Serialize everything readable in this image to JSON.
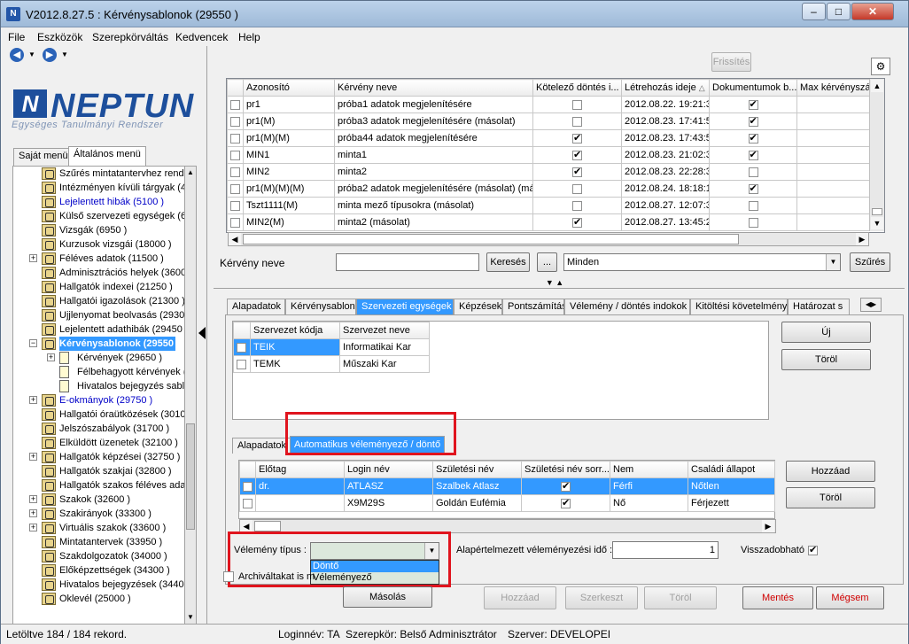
{
  "window": {
    "title": "V2012.8.27.5 : Kérvénysablonok (29550 )"
  },
  "menu": [
    "File",
    "Eszközök",
    "Szerepkörváltás",
    "Kedvencek",
    "Help"
  ],
  "logo": {
    "name": "NEPTUN",
    "subtitle": "Egységes Tanulmányi Rendszer"
  },
  "left_tabs": [
    "Saját menü",
    "Általános menü"
  ],
  "tree": [
    {
      "label": "Szűrés mintatantervhez rende",
      "style": "normal",
      "indent": 1,
      "icon": "tree-node-icon"
    },
    {
      "label": "Intézményen kívüli tárgyak (4",
      "style": "normal",
      "indent": 1,
      "icon": "tree-node-icon"
    },
    {
      "label": "Lejelentett hibák (5100 )",
      "style": "blue",
      "indent": 1,
      "icon": "tree-node-icon"
    },
    {
      "label": "Külső szervezeti egységek (6",
      "style": "normal",
      "indent": 1,
      "icon": "tree-node-icon"
    },
    {
      "label": "Vizsgák (6950 )",
      "style": "normal",
      "indent": 1,
      "icon": "tree-node-icon"
    },
    {
      "label": "Kurzusok vizsgái (18000 )",
      "style": "normal",
      "indent": 1,
      "icon": "tree-node-icon"
    },
    {
      "label": "Féléves adatok (11500 )",
      "style": "normal",
      "indent": 1,
      "icon": "tree-node-icon",
      "expander": "+"
    },
    {
      "label": "Adminisztrációs helyek (3600",
      "style": "normal",
      "indent": 1,
      "icon": "tree-node-icon"
    },
    {
      "label": "Hallgatók indexei (21250 )",
      "style": "normal",
      "indent": 1,
      "icon": "tree-node-icon"
    },
    {
      "label": "Hallgatói igazolások (21300 )",
      "style": "normal",
      "indent": 1,
      "icon": "tree-node-icon"
    },
    {
      "label": "Ujjlenyomat beolvasás (29300",
      "style": "normal",
      "indent": 1,
      "icon": "tree-node-icon"
    },
    {
      "label": "Lejelentett adathibák (29450",
      "style": "normal",
      "indent": 1,
      "icon": "tree-node-icon"
    },
    {
      "label": "Kérvénysablonok (29550",
      "style": "selected",
      "indent": 1,
      "icon": "tree-node-icon",
      "expander": "−"
    },
    {
      "label": "Kérvények (29650 )",
      "style": "normal",
      "indent": 2,
      "icon": "doc",
      "expander": "+"
    },
    {
      "label": "Félbehagyott kérvények (",
      "style": "normal",
      "indent": 2,
      "icon": "doc"
    },
    {
      "label": "Hivatalos bejegyzés sablo",
      "style": "normal",
      "indent": 2,
      "icon": "doc"
    },
    {
      "label": "E-okmányok (29750 )",
      "style": "blue",
      "indent": 1,
      "icon": "tree-node-icon",
      "expander": "+"
    },
    {
      "label": "Hallgatói óraütközések (3010",
      "style": "normal",
      "indent": 1,
      "icon": "tree-node-icon"
    },
    {
      "label": "Jelszószabályok (31700 )",
      "style": "normal",
      "indent": 1,
      "icon": "tree-node-icon"
    },
    {
      "label": "Elküldött üzenetek (32100 )",
      "style": "normal",
      "indent": 1,
      "icon": "tree-node-icon"
    },
    {
      "label": "Hallgatók képzései (32750 )",
      "style": "normal",
      "indent": 1,
      "icon": "tree-node-icon",
      "expander": "+"
    },
    {
      "label": "Hallgatók szakjai (32800 )",
      "style": "normal",
      "indent": 1,
      "icon": "tree-node-icon"
    },
    {
      "label": "Hallgatók szakos féléves ada",
      "style": "normal",
      "indent": 1,
      "icon": "tree-node-icon"
    },
    {
      "label": "Szakok (32600 )",
      "style": "normal",
      "indent": 1,
      "icon": "tree-node-icon",
      "expander": "+"
    },
    {
      "label": "Szakirányok (33300 )",
      "style": "normal",
      "indent": 1,
      "icon": "tree-node-icon",
      "expander": "+"
    },
    {
      "label": "Virtuális szakok (33600 )",
      "style": "normal",
      "indent": 1,
      "icon": "tree-node-icon",
      "expander": "+"
    },
    {
      "label": "Mintatantervek (33950 )",
      "style": "normal",
      "indent": 1,
      "icon": "tree-node-icon"
    },
    {
      "label": "Szakdolgozatok (34000 )",
      "style": "normal",
      "indent": 1,
      "icon": "tree-node-icon"
    },
    {
      "label": "Előképzettségek (34300 )",
      "style": "normal",
      "indent": 1,
      "icon": "tree-node-icon"
    },
    {
      "label": "Hivatalos bejegyzések (34400",
      "style": "normal",
      "indent": 1,
      "icon": "tree-node-icon"
    },
    {
      "label": "Oklevél (25000 )",
      "style": "normal",
      "indent": 1,
      "icon": "tree-node-icon"
    }
  ],
  "toolbar": {
    "refresh": "Frissítés"
  },
  "main_grid": {
    "columns": [
      "Azonosító",
      "Kérvény neve",
      "Kötelező döntés i...",
      "Létrehozás ideje",
      "Dokumentumok b...",
      "Max kérvényszám"
    ],
    "sort_indicator": "△",
    "rows": [
      {
        "id": "pr1",
        "name": "próba1 adatok megjelenítésére",
        "required": false,
        "created": "2012.08.22. 19:21:3",
        "docs": true
      },
      {
        "id": "pr1(M)",
        "name": "próba3 adatok megjelenítésére (másolat)",
        "required": false,
        "created": "2012.08.23. 17:41:5",
        "docs": true
      },
      {
        "id": "pr1(M)(M)",
        "name": "próba44 adatok megjelenítésére",
        "required": true,
        "created": "2012.08.23. 17:43:5",
        "docs": true
      },
      {
        "id": "MIN1",
        "name": "minta1",
        "required": true,
        "created": "2012.08.23. 21:02:3",
        "docs": true
      },
      {
        "id": "MIN2",
        "name": "minta2",
        "required": true,
        "created": "2012.08.23. 22:28:3",
        "docs": false
      },
      {
        "id": "pr1(M)(M)(M)",
        "name": "próba2 adatok megjelenítésére (másolat) (máso",
        "required": false,
        "created": "2012.08.24. 18:18:1",
        "docs": true
      },
      {
        "id": "Tszt1111(M)",
        "name": "minta mező típusokra (másolat)",
        "required": false,
        "created": "2012.08.27. 12:07:3",
        "docs": false
      },
      {
        "id": "MIN2(M)",
        "name": "minta2 (másolat)",
        "required": true,
        "created": "2012.08.27. 13:45:2",
        "docs": false
      }
    ]
  },
  "filter": {
    "label": "Kérvény neve",
    "value": "",
    "search": "Keresés",
    "ellipsis": "...",
    "dropdown": "Minden",
    "filter_btn": "Szűrés"
  },
  "detail_tabs": [
    "Alapadatok",
    "Kérvénysablon",
    "Szervezeti egységek",
    "Képzések",
    "Pontszámítás",
    "Vélemény / döntés indokok",
    "Kitöltési követelmény",
    "Határozat s"
  ],
  "org_grid": {
    "columns": [
      "Szervezet kódja",
      "Szervezet neve"
    ],
    "rows": [
      {
        "code": "TEIK",
        "name": "Informatikai Kar",
        "selected": true
      },
      {
        "code": "TEMK",
        "name": "Műszaki Kar",
        "selected": false
      }
    ]
  },
  "org_buttons": {
    "new": "Új",
    "delete": "Töröl"
  },
  "sub_tabs": [
    "Alapadatok",
    "Automatikus véleményező / döntő"
  ],
  "reviewer_grid": {
    "columns": [
      "Előtag",
      "Login név",
      "Születési név",
      "Születési név sorr...",
      "Nem",
      "Családi állapot"
    ],
    "rows": [
      {
        "prefix": "dr.",
        "login": "ATLASZ",
        "birth_name": "Szalbek Atlasz",
        "order": true,
        "sex": "Férfi",
        "marital": "Nőtlen",
        "selected": true
      },
      {
        "prefix": "",
        "login": "X9M29S",
        "birth_name": "Goldán Eufémia",
        "order": true,
        "sex": "Nő",
        "marital": "Férjezett",
        "selected": false
      }
    ]
  },
  "reviewer_buttons": {
    "add": "Hozzáad",
    "delete": "Töröl"
  },
  "opinion": {
    "type_label": "Vélemény típus :",
    "type_value": "",
    "options": [
      "Döntő",
      "Véleményező"
    ],
    "default_time_label": "Alapértelmezett véleményezési idő :",
    "default_time_value": "1",
    "revocable_label": "Visszadobható",
    "revocable": true
  },
  "archive": {
    "label": "Archiváltakat is m"
  },
  "bottom_buttons": {
    "copy": "Másolás",
    "add": "Hozzáad",
    "edit": "Szerkeszt",
    "delete": "Töröl",
    "save": "Mentés",
    "cancel": "Mégsem"
  },
  "status": {
    "records": "Letöltve 184 / 184 rekord.",
    "login": "Loginnév: TA",
    "role": "Szerepkör: Belső Adminisztrátor",
    "server": "Szerver: DEVELOPEI"
  },
  "colors": {
    "accent": "#3399ff",
    "highlight": "#e0141e",
    "title": "#1d4f9c"
  }
}
